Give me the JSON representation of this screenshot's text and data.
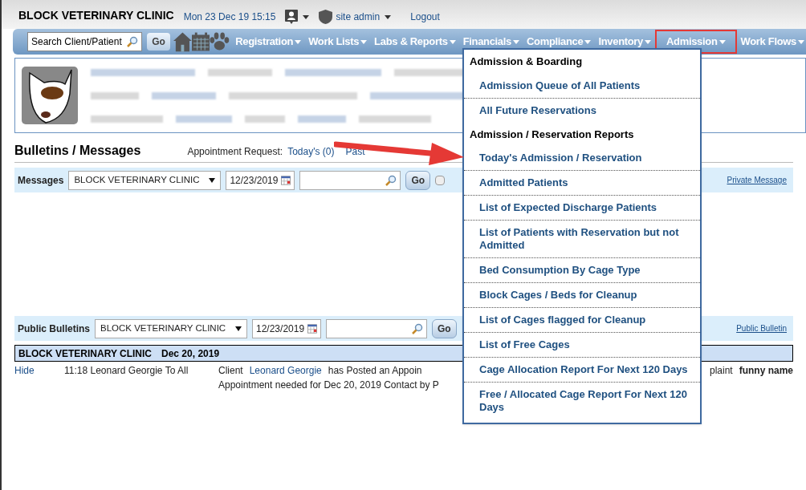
{
  "header": {
    "clinic": "BLOCK VETERINARY CLINIC",
    "datetime": "Mon 23 Dec 19 15:15",
    "user": "site admin",
    "logout": "Logout"
  },
  "nav": {
    "search_placeholder": "Search Client/Patient",
    "go": "Go",
    "menus": [
      {
        "label": "Registration",
        "selected": false
      },
      {
        "label": "Work Lists",
        "selected": false
      },
      {
        "label": "Labs & Reports",
        "selected": false
      },
      {
        "label": "Financials",
        "selected": false
      },
      {
        "label": "Compliance",
        "selected": false
      },
      {
        "label": "Inventory",
        "selected": false
      },
      {
        "label": "Admission",
        "selected": true
      },
      {
        "label": "Work Flows",
        "selected": false
      }
    ]
  },
  "bulletins": {
    "title": "Bulletins / Messages",
    "appointment_label": "Appointment Request:",
    "appointment_links": [
      "Today's (0)",
      "Past"
    ]
  },
  "messages_bar": {
    "label": "Messages",
    "clinic": "BLOCK VETERINARY CLINIC",
    "date": "12/23/2019",
    "go": "Go",
    "checked": false,
    "link": "Private Message"
  },
  "public_bar": {
    "label": "Public Bulletins",
    "clinic": "BLOCK VETERINARY CLINIC",
    "date": "12/23/2019",
    "go": "Go",
    "link": "Public Bulletin"
  },
  "bulletin_group": {
    "clinic": "BLOCK VETERINARY CLINIC",
    "date": "Dec 20, 2019"
  },
  "bulletin_rows": [
    {
      "action": "Hide",
      "time_from": "11:18 Leonard Georgie To All",
      "client_prefix": "Client",
      "client": "Leonard Georgie",
      "line1_rest": "has Posted an Appoin",
      "line1_tail": "plaint",
      "tail_bold": "funny name",
      "line2": "Appointment needed for Dec 20, 2019 Contact by P"
    }
  ],
  "dropdown": {
    "items": [
      {
        "kind": "header",
        "label": "Admission & Boarding"
      },
      {
        "kind": "item",
        "label": "Admission Queue of All Patients"
      },
      {
        "kind": "item",
        "label": "All Future Reservations"
      },
      {
        "kind": "header",
        "label": "Admission / Reservation Reports"
      },
      {
        "kind": "item",
        "label": "Today's Admission / Reservation"
      },
      {
        "kind": "item",
        "label": "Admitted Patients"
      },
      {
        "kind": "item",
        "label": "List of Expected Discharge Patients"
      },
      {
        "kind": "item",
        "label": "List of Patients with Reservation but not Admitted"
      },
      {
        "kind": "item",
        "label": "Bed Consumption By Cage Type"
      },
      {
        "kind": "item",
        "label": "Block Cages / Beds for Cleanup"
      },
      {
        "kind": "item",
        "label": "List of Cages flagged for Cleanup"
      },
      {
        "kind": "item",
        "label": "List of Free Cages"
      },
      {
        "kind": "item",
        "label": "Cage Allocation Report For Next 120 Days"
      },
      {
        "kind": "item",
        "label": "Free / Allocated Cage Report For Next 120 Days"
      }
    ]
  }
}
